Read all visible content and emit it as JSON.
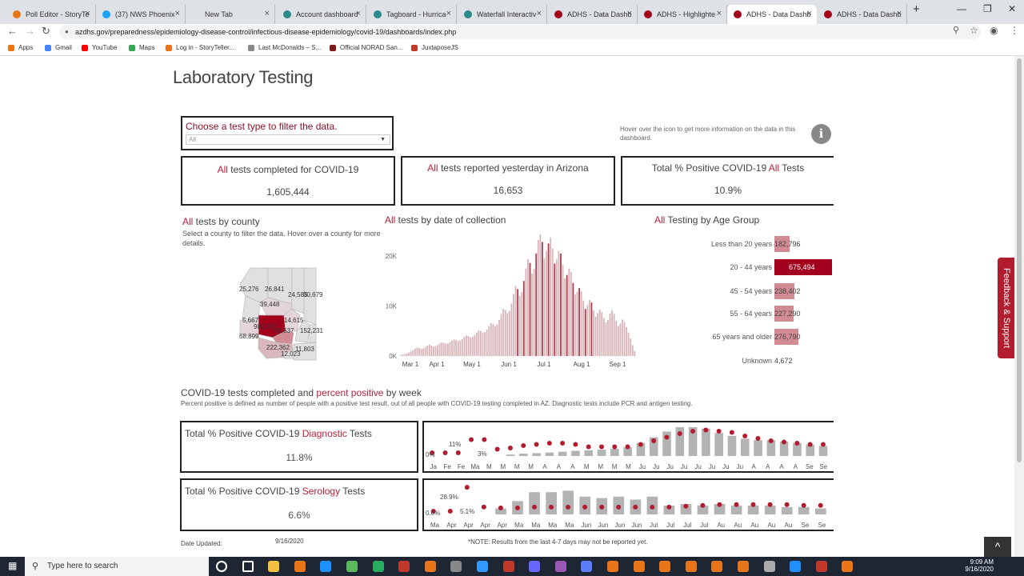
{
  "browser": {
    "tabs": [
      {
        "title": "Poll Editor - StoryTe",
        "color": "#e8751a"
      },
      {
        "title": "(37) NWS Phoenix",
        "color": "#1da1f2"
      },
      {
        "title": "New Tab",
        "color": "#dee1e6"
      },
      {
        "title": "Account dashboard",
        "color": "#2a8a8a"
      },
      {
        "title": "Tagboard - Hurrica",
        "color": "#2a8a8a"
      },
      {
        "title": "Waterfall Interactiv",
        "color": "#2a8a8a"
      },
      {
        "title": "ADHS - Data Dashb",
        "color": "#a3001e"
      },
      {
        "title": "ADHS - Highlighte",
        "color": "#a3001e"
      },
      {
        "title": "ADHS - Data Dashb",
        "color": "#a3001e"
      },
      {
        "title": "ADHS - Data Dashb",
        "color": "#a3001e"
      }
    ],
    "url": "azdhs.gov/preparedness/epidemiology-disease-control/infectious-disease-epidemiology/covid-19/dashboards/index.php",
    "bookmarks": [
      {
        "label": "Apps",
        "color": "#e8751a"
      },
      {
        "label": "Gmail",
        "color": "#4285f4"
      },
      {
        "label": "YouTube",
        "color": "#ff0000"
      },
      {
        "label": "Maps",
        "color": "#34a853"
      },
      {
        "label": "Log in - StoryTeller...",
        "color": "#e8751a"
      },
      {
        "label": "Last McDonalds – S...",
        "color": "#888888"
      },
      {
        "label": "Official NORAD San...",
        "color": "#7a1e1e"
      },
      {
        "label": "JuxtaposeJS",
        "color": "#c0392b"
      }
    ],
    "icons": {
      "back": "arrow-left-icon",
      "forward": "arrow-right-icon",
      "reload": "reload-icon",
      "lock": "lock-icon",
      "zoom": "zoom-icon",
      "star": "star-icon",
      "profile": "profile-icon",
      "menu": "menu-icon"
    }
  },
  "page": {
    "title": "Laboratory Testing",
    "filter": {
      "label": "Choose a test type to filter the data.",
      "value": "All"
    },
    "hover_note": "Hover over the icon to get more information on the data in this dashboard.",
    "kpis": [
      {
        "accent": "All",
        "text": " tests completed for COVID-19",
        "value": "1,605,444"
      },
      {
        "accent": "All",
        "text": " tests reported yesterday in Arizona",
        "value": "16,653"
      },
      {
        "prefix": "Total % Positive COVID-19 ",
        "accent": "All",
        "text": " Tests",
        "value": "10.9%"
      }
    ],
    "county": {
      "accent": "All",
      "title": " tests by county",
      "subtitle": "Select a county to filter the data. Hover over a county for more details.",
      "labels": [
        "25,276",
        "26,841",
        "24,585",
        "30,679",
        "39,448",
        "5,667",
        "14,615",
        "982,207",
        "69,637",
        "68,899",
        "152,231",
        "11,803",
        "222,362",
        "12,023"
      ]
    },
    "date_chart": {
      "accent": "All",
      "title": " tests by date of collection",
      "y_ticks": [
        "20K",
        "10K",
        "0K"
      ],
      "x_ticks": [
        "Mar 1",
        "Apr 1",
        "May 1",
        "Jun 1",
        "Jul 1",
        "Aug 1",
        "Sep 1"
      ]
    },
    "age": {
      "accent": "All",
      "title": " Testing by Age Group",
      "groups": [
        {
          "label": "Less than 20 years",
          "value": "182,796",
          "n": 182796
        },
        {
          "label": "20 - 44 years",
          "value": "675,494",
          "n": 675494
        },
        {
          "label": "45 - 54 years",
          "value": "238,402",
          "n": 238402
        },
        {
          "label": "55 - 64 years",
          "value": "227,290",
          "n": 227290
        },
        {
          "label": "65 years and older",
          "value": "276,790",
          "n": 276790
        },
        {
          "label": "Unknown",
          "value": "4,672",
          "n": 4672
        }
      ]
    },
    "weekly": {
      "title_a": "COVID-19 tests completed and ",
      "title_b": "percent positive",
      "title_c": " by week",
      "subtitle": "Percent positive is defined as number of people with a positive test result, out of all people with COVID-19 testing completed in AZ. Diagnostic tests include PCR and antigen testing."
    },
    "diagnostic": {
      "prefix": "Total % Positive COVID-19 ",
      "accent": "Diagnostic",
      "suffix": " Tests",
      "value": "11.8%",
      "labels": [
        "0%",
        "11%",
        "3%"
      ],
      "x_ticks": [
        "Ja",
        "Fe",
        "Fe",
        "Ma",
        "M",
        "M",
        "M",
        "M",
        "A",
        "A",
        "A",
        "M",
        "M",
        "M",
        "M",
        "Ju",
        "Ju",
        "Ju",
        "Ju",
        "Ju",
        "Ju",
        "Ju",
        "Ju",
        "A",
        "A",
        "A",
        "A",
        "Se",
        "Se"
      ]
    },
    "serology": {
      "prefix": "Total % Positive COVID-19 ",
      "accent": "Serology",
      "suffix": " Tests",
      "value": "6.6%",
      "labels": [
        "28.9%",
        "0.0%",
        "5.1%"
      ],
      "x_ticks": [
        "Ma",
        "Apr",
        "Apr",
        "Apr",
        "Apr",
        "Ma",
        "Ma",
        "Ma",
        "Ma",
        "Jun",
        "Jun",
        "Jun",
        "Jun",
        "Jul",
        "Jul",
        "Jul",
        "Jul",
        "Au",
        "Au",
        "Au",
        "Au",
        "Au",
        "Se",
        "Se"
      ]
    },
    "footer": {
      "updated_label": "Date Updated:",
      "updated_value": "9/16/2020",
      "note": "*NOTE: Results from the last 4-7 days may not be reported yet."
    },
    "feedback": "Feedback & Support",
    "to_top": "^"
  },
  "chart_data": [
    {
      "type": "bar",
      "title": "All tests by date of collection",
      "x_ticks": [
        "Mar 1",
        "Apr 1",
        "May 1",
        "Jun 1",
        "Jul 1",
        "Aug 1",
        "Sep 1"
      ],
      "ylim": [
        0,
        24000
      ],
      "peak_date": "Jul 1",
      "values": [
        200,
        300,
        400,
        500,
        700,
        900,
        1200,
        1500,
        1700,
        1600,
        1400,
        1500,
        1800,
        2100,
        2300,
        2100,
        1900,
        2000,
        2200,
        2500,
        2700,
        2600,
        2400,
        2500,
        2800,
        3100,
        3300,
        3200,
        3000,
        3100,
        3400,
        3800,
        4100,
        4000,
        3700,
        3800,
        4200,
        4700,
        5100,
        5000,
        4700,
        4800,
        5300,
        6000,
        6600,
        6400,
        6000,
        6300,
        7200,
        8400,
        9400,
        9200,
        8600,
        9000,
        10500,
        12400,
        14000,
        13400,
        12000,
        12800,
        15000,
        17500,
        19400,
        18600,
        16500,
        17500,
        20500,
        23200,
        24300,
        22800,
        19500,
        21000,
        22500,
        23700,
        21500,
        18500,
        19300,
        21000,
        20500,
        18200,
        15500,
        16200,
        17500,
        16800,
        14600,
        12300,
        12800,
        13600,
        12900,
        11100,
        9400,
        10200,
        11200,
        10700,
        9100,
        7900,
        8600,
        9300,
        8800,
        7600,
        6700,
        7200,
        8500,
        9200,
        8400,
        7000,
        6000,
        6500,
        7300,
        6800,
        5800,
        4700,
        3500,
        2200,
        1000
      ]
    },
    {
      "type": "bar",
      "title": "All Testing by Age Group",
      "categories": [
        "Less than 20 years",
        "20 - 44 years",
        "45 - 54 years",
        "55 - 64 years",
        "65 years and older",
        "Unknown"
      ],
      "values": [
        182796,
        675494,
        238402,
        227290,
        276790,
        4672
      ]
    },
    {
      "type": "bar",
      "title": "Total % Positive COVID-19 Diagnostic Tests",
      "tests": [
        0,
        0,
        0,
        0,
        0,
        0,
        0.05,
        0.08,
        0.1,
        0.12,
        0.15,
        0.18,
        0.2,
        0.22,
        0.25,
        0.3,
        0.45,
        0.65,
        0.85,
        1,
        1,
        0.95,
        0.8,
        0.7,
        0.6,
        0.55,
        0.55,
        0.5,
        0.45,
        0.4,
        0.35
      ],
      "pct_positive": [
        0,
        0,
        0,
        11,
        11,
        3,
        4,
        6,
        7,
        8,
        8,
        7,
        5,
        5,
        5,
        5,
        7,
        10,
        13,
        16,
        18,
        19,
        18,
        17,
        14,
        12,
        10,
        9,
        8,
        7,
        7
      ]
    },
    {
      "type": "bar",
      "title": "Total % Positive COVID-19 Serology Tests",
      "tests": [
        0,
        0,
        0,
        0,
        0.2,
        0.45,
        0.75,
        0.75,
        0.8,
        0.6,
        0.55,
        0.6,
        0.5,
        0.6,
        0.3,
        0.35,
        0.3,
        0.35,
        0.3,
        0.3,
        0.3,
        0.25,
        0.25,
        0.2
      ],
      "pct_positive": [
        0,
        0,
        28.9,
        5.1,
        4,
        4,
        5,
        5,
        5,
        5,
        5,
        5,
        5,
        5,
        5,
        6,
        7,
        8,
        8,
        8,
        8,
        8,
        7,
        7
      ]
    }
  ]
}
